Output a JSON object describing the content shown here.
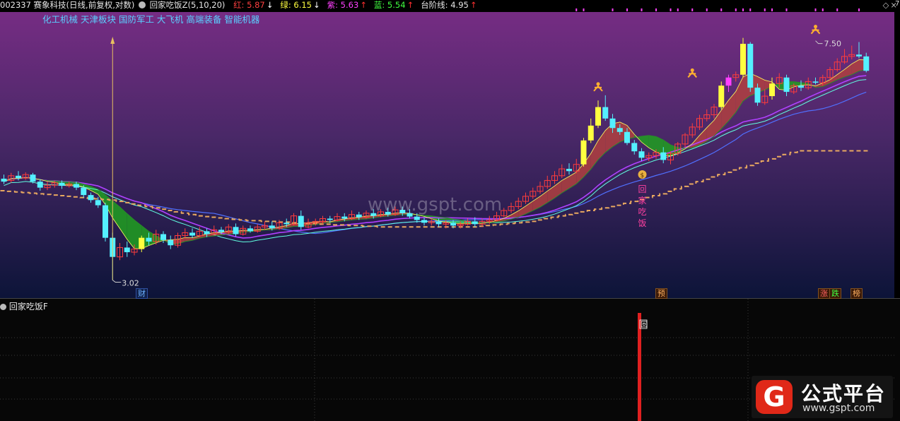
{
  "header": {
    "stock": "002337 赛象科技(日线,前复权,对数)",
    "indicator_name": "回家吃饭Z(5,10,20)",
    "values": [
      {
        "label": "红:",
        "value": "5.87",
        "arrow": "↓",
        "color": "#ff4040",
        "arrow_color": "#ffffff"
      },
      {
        "label": "绿:",
        "value": "6.15",
        "arrow": "↓",
        "color": "#ffff40",
        "arrow_color": "#ffffff"
      },
      {
        "label": "紫:",
        "value": "5.63",
        "arrow": "↑",
        "color": "#ff40ff",
        "arrow_color": "#ff3030"
      },
      {
        "label": "蓝:",
        "value": "5.54",
        "arrow": "↑",
        "color": "#40ff40",
        "arrow_color": "#ff3030"
      },
      {
        "label": "台阶线:",
        "value": "4.95",
        "arrow": "↑",
        "color": "#e6e6e6",
        "arrow_color": "#ff3030"
      }
    ]
  },
  "sectors": "化工机械 天津板块 国防军工 大飞机 高端装备 智能机器",
  "watermark": "www.gspt.com",
  "annotations": {
    "high_label": "7.50",
    "low_label": "3.02",
    "signal_text": [
      "回",
      "家",
      "吃",
      "饭"
    ],
    "sub_marker": "回",
    "right_edge": "7"
  },
  "bottom_markers": [
    {
      "text": "财",
      "color": "#6ab0ff"
    },
    {
      "text": "预",
      "color": "#ffb060"
    },
    {
      "text": "涨",
      "color": "#ff6060"
    },
    {
      "text": "跌",
      "color": "#40ff40"
    },
    {
      "text": "榜",
      "color": "#ffb060"
    }
  ],
  "sub_panel": {
    "title": "回家吃饭F"
  },
  "logo": {
    "g": "G",
    "name": "公式平台",
    "url": "www.gspt.com"
  },
  "colors": {
    "up": "#ff3c3c",
    "down": "#54f0ff",
    "step": "#e8a860",
    "ma_purple": "#b040ff",
    "ma_blue": "#5070ff",
    "ma_cyan": "#60ffe0",
    "fill_red": "#b04040",
    "fill_green": "#20a020"
  },
  "chart_data": {
    "type": "candlestick",
    "scale": "log",
    "ylim": [
      2.85,
      8.3
    ],
    "candles": [
      [
        4.45,
        4.4,
        4.52,
        4.36
      ],
      [
        4.42,
        4.5,
        4.55,
        4.38
      ],
      [
        4.5,
        4.46,
        4.58,
        4.42
      ],
      [
        4.46,
        4.52,
        4.56,
        4.43
      ],
      [
        4.52,
        4.4,
        4.55,
        4.37
      ],
      [
        4.4,
        4.3,
        4.44,
        4.25
      ],
      [
        4.3,
        4.34,
        4.4,
        4.26
      ],
      [
        4.34,
        4.38,
        4.42,
        4.3
      ],
      [
        4.38,
        4.33,
        4.42,
        4.28
      ],
      [
        4.33,
        4.36,
        4.4,
        4.3
      ],
      [
        4.36,
        4.3,
        4.4,
        4.26
      ],
      [
        4.3,
        4.18,
        4.34,
        4.14
      ],
      [
        4.18,
        4.1,
        4.22,
        4.06
      ],
      [
        4.1,
        4.02,
        4.15,
        3.98
      ],
      [
        4.02,
        3.55,
        4.06,
        3.5
      ],
      [
        3.55,
        3.3,
        3.62,
        3.02
      ],
      [
        3.3,
        3.42,
        3.48,
        3.26
      ],
      [
        3.42,
        3.36,
        3.5,
        3.3
      ],
      [
        3.36,
        3.4,
        3.46,
        3.32
      ],
      [
        3.4,
        3.55,
        3.58,
        3.36
      ],
      [
        3.55,
        3.5,
        3.62,
        3.45
      ],
      [
        3.5,
        3.6,
        3.66,
        3.46
      ],
      [
        3.6,
        3.52,
        3.64,
        3.48
      ],
      [
        3.52,
        3.45,
        3.58,
        3.4
      ],
      [
        3.45,
        3.58,
        3.62,
        3.42
      ],
      [
        3.58,
        3.62,
        3.68,
        3.54
      ],
      [
        3.62,
        3.58,
        3.68,
        3.55
      ],
      [
        3.58,
        3.64,
        3.7,
        3.56
      ],
      [
        3.64,
        3.6,
        3.68,
        3.56
      ],
      [
        3.6,
        3.66,
        3.72,
        3.58
      ],
      [
        3.66,
        3.63,
        3.7,
        3.6
      ],
      [
        3.63,
        3.7,
        3.74,
        3.6
      ],
      [
        3.7,
        3.6,
        3.75,
        3.57
      ],
      [
        3.6,
        3.68,
        3.72,
        3.58
      ],
      [
        3.68,
        3.64,
        3.72,
        3.62
      ],
      [
        3.64,
        3.7,
        3.74,
        3.62
      ],
      [
        3.7,
        3.72,
        3.78,
        3.66
      ],
      [
        3.72,
        3.68,
        3.78,
        3.65
      ],
      [
        3.68,
        3.76,
        3.8,
        3.66
      ],
      [
        3.76,
        3.74,
        3.82,
        3.7
      ],
      [
        3.74,
        3.86,
        3.9,
        3.72
      ],
      [
        3.86,
        3.7,
        3.94,
        3.66
      ],
      [
        3.7,
        3.76,
        3.82,
        3.68
      ],
      [
        3.76,
        3.78,
        3.82,
        3.72
      ],
      [
        3.78,
        3.82,
        3.86,
        3.74
      ],
      [
        3.82,
        3.8,
        3.86,
        3.76
      ],
      [
        3.8,
        3.85,
        3.9,
        3.78
      ],
      [
        3.85,
        3.82,
        3.9,
        3.78
      ],
      [
        3.82,
        3.88,
        3.94,
        3.8
      ],
      [
        3.88,
        3.84,
        3.92,
        3.8
      ],
      [
        3.84,
        3.9,
        3.94,
        3.82
      ],
      [
        3.9,
        3.86,
        3.96,
        3.82
      ],
      [
        3.86,
        3.92,
        3.96,
        3.84
      ],
      [
        3.92,
        3.88,
        3.98,
        3.85
      ],
      [
        3.88,
        3.95,
        4.0,
        3.86
      ],
      [
        3.95,
        3.9,
        4.0,
        3.86
      ],
      [
        3.9,
        3.85,
        3.96,
        3.82
      ],
      [
        3.85,
        3.8,
        3.9,
        3.76
      ],
      [
        3.8,
        3.76,
        3.84,
        3.72
      ],
      [
        3.76,
        3.78,
        3.82,
        3.72
      ],
      [
        3.78,
        3.74,
        3.82,
        3.7
      ],
      [
        3.74,
        3.76,
        3.8,
        3.68
      ],
      [
        3.76,
        3.72,
        3.8,
        3.68
      ],
      [
        3.72,
        3.74,
        3.78,
        3.68
      ],
      [
        3.74,
        3.78,
        3.82,
        3.72
      ],
      [
        3.78,
        3.74,
        3.84,
        3.7
      ],
      [
        3.74,
        3.78,
        3.82,
        3.7
      ],
      [
        3.78,
        3.8,
        3.86,
        3.74
      ],
      [
        3.8,
        3.86,
        3.92,
        3.78
      ],
      [
        3.86,
        3.94,
        3.98,
        3.84
      ],
      [
        3.94,
        4.0,
        4.06,
        3.9
      ],
      [
        4.0,
        4.08,
        4.14,
        3.96
      ],
      [
        4.08,
        4.16,
        4.22,
        4.04
      ],
      [
        4.16,
        4.24,
        4.3,
        4.12
      ],
      [
        4.24,
        4.32,
        4.4,
        4.2
      ],
      [
        4.32,
        4.42,
        4.5,
        4.28
      ],
      [
        4.42,
        4.5,
        4.58,
        4.36
      ],
      [
        4.5,
        4.62,
        4.7,
        4.46
      ],
      [
        4.62,
        4.58,
        4.72,
        4.52
      ],
      [
        4.58,
        4.7,
        4.8,
        4.54
      ],
      [
        4.7,
        5.15,
        5.2,
        4.66
      ],
      [
        5.15,
        5.45,
        5.6,
        5.1
      ],
      [
        5.45,
        5.85,
        6.0,
        5.4
      ],
      [
        5.85,
        5.6,
        6.12,
        5.55
      ],
      [
        5.6,
        5.4,
        5.7,
        5.3
      ],
      [
        5.4,
        5.32,
        5.48,
        5.26
      ],
      [
        5.32,
        5.1,
        5.4,
        5.06
      ],
      [
        5.1,
        4.94,
        5.16,
        4.88
      ],
      [
        4.94,
        4.82,
        5.0,
        4.76
      ],
      [
        4.82,
        4.86,
        4.92,
        4.76
      ],
      [
        4.86,
        4.92,
        4.98,
        4.8
      ],
      [
        4.92,
        4.78,
        5.02,
        4.72
      ],
      [
        4.78,
        4.9,
        4.94,
        4.7
      ],
      [
        4.9,
        5.08,
        5.12,
        4.86
      ],
      [
        5.08,
        5.26,
        5.3,
        5.02
      ],
      [
        5.26,
        5.42,
        5.5,
        5.2
      ],
      [
        5.42,
        5.6,
        5.68,
        5.36
      ],
      [
        5.6,
        5.68,
        5.8,
        5.54
      ],
      [
        5.68,
        5.85,
        5.92,
        5.6
      ],
      [
        5.85,
        6.35,
        6.45,
        5.8
      ],
      [
        6.35,
        6.55,
        6.62,
        6.2
      ],
      [
        6.55,
        6.62,
        6.7,
        6.45
      ],
      [
        6.62,
        7.45,
        7.62,
        6.55
      ],
      [
        7.45,
        6.3,
        7.5,
        6.2
      ],
      [
        6.3,
        5.95,
        6.4,
        5.88
      ],
      [
        5.95,
        6.1,
        6.26,
        5.9
      ],
      [
        6.1,
        6.4,
        6.55,
        6.02
      ],
      [
        6.4,
        6.55,
        6.66,
        6.3
      ],
      [
        6.55,
        6.2,
        6.62,
        6.1
      ],
      [
        6.2,
        6.35,
        6.4,
        6.15
      ],
      [
        6.35,
        6.3,
        6.48,
        6.22
      ],
      [
        6.3,
        6.45,
        6.55,
        6.25
      ],
      [
        6.45,
        6.42,
        6.55,
        6.38
      ],
      [
        6.42,
        6.55,
        6.62,
        6.35
      ],
      [
        6.55,
        6.75,
        6.82,
        6.48
      ],
      [
        6.75,
        6.95,
        7.05,
        6.7
      ],
      [
        6.95,
        7.1,
        7.3,
        6.9
      ],
      [
        7.1,
        7.15,
        7.4,
        7.02
      ],
      [
        7.15,
        7.1,
        7.5,
        7.05
      ],
      [
        7.1,
        6.72,
        7.2,
        6.68
      ]
    ],
    "step_line": [
      4.25,
      4.24,
      4.23,
      4.22,
      4.21,
      4.2,
      4.19,
      4.18,
      4.17,
      4.16,
      4.15,
      4.14,
      4.13,
      4.12,
      4.11,
      4.1,
      4.08,
      4.06,
      4.04,
      4.02,
      4.0,
      3.98,
      3.96,
      3.94,
      3.92,
      3.9,
      3.88,
      3.86,
      3.85,
      3.84,
      3.83,
      3.82,
      3.81,
      3.8,
      3.79,
      3.79,
      3.78,
      3.78,
      3.77,
      3.77,
      3.76,
      3.76,
      3.75,
      3.75,
      3.74,
      3.74,
      3.73,
      3.73,
      3.72,
      3.72,
      3.71,
      3.71,
      3.7,
      3.7,
      3.7,
      3.7,
      3.7,
      3.7,
      3.7,
      3.7,
      3.7,
      3.7,
      3.7,
      3.7,
      3.7,
      3.7,
      3.71,
      3.72,
      3.73,
      3.74,
      3.75,
      3.76,
      3.77,
      3.78,
      3.8,
      3.82,
      3.84,
      3.86,
      3.88,
      3.9,
      3.92,
      3.94,
      3.96,
      3.98,
      4.0,
      4.02,
      4.05,
      4.08,
      4.11,
      4.14,
      4.17,
      4.2,
      4.24,
      4.28,
      4.32,
      4.36,
      4.4,
      4.44,
      4.48,
      4.52,
      4.56,
      4.6,
      4.64,
      4.68,
      4.72,
      4.76,
      4.8,
      4.84,
      4.88,
      4.92,
      4.95,
      4.95,
      4.95,
      4.95,
      4.95,
      4.95,
      4.95,
      4.95,
      4.95,
      4.95
    ]
  }
}
